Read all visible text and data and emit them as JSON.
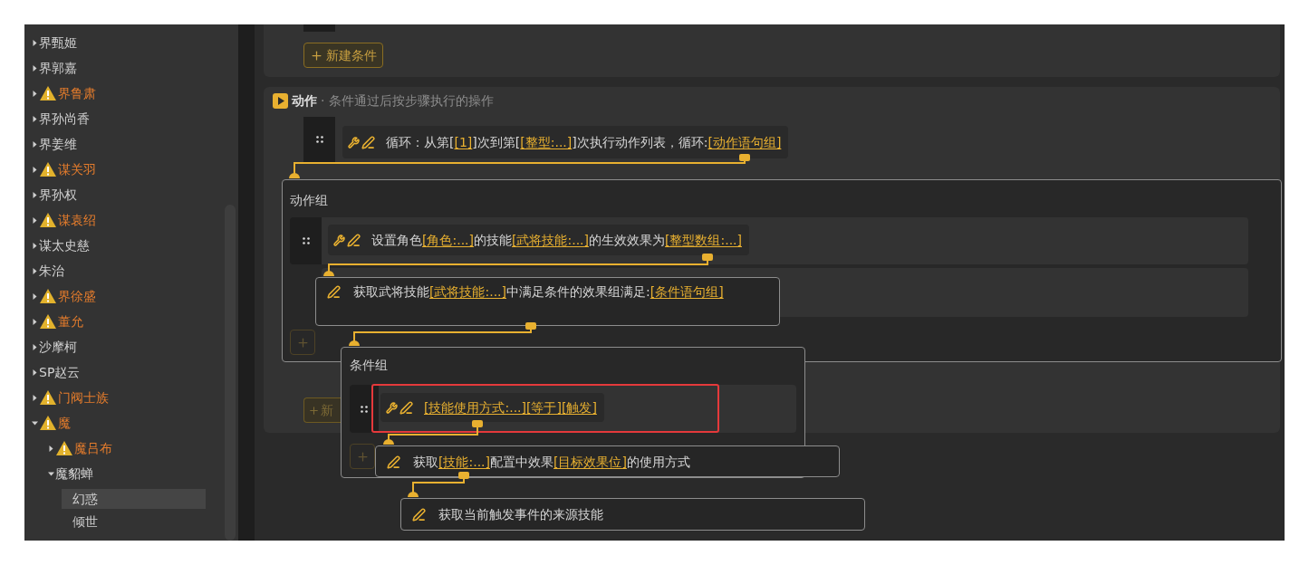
{
  "sidebar": {
    "items": [
      {
        "label": "界甄姬",
        "warning": false,
        "kind": "folder",
        "expanded": false,
        "selected": false
      },
      {
        "label": "界郭嘉",
        "warning": false,
        "kind": "folder",
        "expanded": false,
        "selected": false
      },
      {
        "label": "界鲁肃",
        "warning": true,
        "kind": "folder",
        "expanded": false,
        "selected": false
      },
      {
        "label": "界孙尚香",
        "warning": false,
        "kind": "folder",
        "expanded": false,
        "selected": false
      },
      {
        "label": "界姜维",
        "warning": false,
        "kind": "folder",
        "expanded": false,
        "selected": false
      },
      {
        "label": "谋关羽",
        "warning": true,
        "kind": "folder",
        "expanded": false,
        "selected": false
      },
      {
        "label": "界孙权",
        "warning": false,
        "kind": "folder",
        "expanded": false,
        "selected": false
      },
      {
        "label": "谋袁绍",
        "warning": true,
        "kind": "folder",
        "expanded": false,
        "selected": false
      },
      {
        "label": "谋太史慈",
        "warning": false,
        "kind": "folder",
        "expanded": false,
        "selected": false
      },
      {
        "label": "朱治",
        "warning": false,
        "kind": "folder",
        "expanded": false,
        "selected": false
      },
      {
        "label": "界徐盛",
        "warning": true,
        "kind": "folder",
        "expanded": false,
        "selected": false
      },
      {
        "label": "董允",
        "warning": true,
        "kind": "folder",
        "expanded": false,
        "selected": false
      },
      {
        "label": "沙摩柯",
        "warning": false,
        "kind": "folder",
        "expanded": false,
        "selected": false
      },
      {
        "label": "SP赵云",
        "warning": false,
        "kind": "folder",
        "expanded": false,
        "selected": false
      },
      {
        "label": "门阀士族",
        "warning": true,
        "kind": "folder",
        "expanded": false,
        "selected": false
      },
      {
        "label": "魔",
        "warning": true,
        "kind": "folder",
        "expanded": true,
        "selected": false,
        "children": [
          {
            "label": "魔吕布",
            "warning": true,
            "kind": "folder",
            "expanded": false,
            "selected": false
          },
          {
            "label": "魔貂蝉",
            "warning": false,
            "kind": "folder",
            "expanded": true,
            "selected": false,
            "children": [
              {
                "label": "幻惑",
                "warning": false,
                "kind": "leaf",
                "selected": true
              },
              {
                "label": "倾世",
                "warning": false,
                "kind": "leaf",
                "selected": false
              }
            ]
          }
        ]
      }
    ]
  },
  "conditions_section": {
    "add_button": "新建条件"
  },
  "actions_section": {
    "title": "动作",
    "subtitle": "· 条件通过后按步骤执行的操作",
    "statement": {
      "wrench": true,
      "segments": [
        {
          "kind": "plain",
          "text": "循环：从第["
        },
        {
          "kind": "param",
          "text": "[1]"
        },
        {
          "kind": "plain",
          "text": "]次到第["
        },
        {
          "kind": "param",
          "text": "[整型:...]"
        },
        {
          "kind": "plain",
          "text": "]次执行动作列表，循环:"
        },
        {
          "kind": "param",
          "text": "[动作语句组]"
        }
      ]
    },
    "partial_add_button": "新"
  },
  "action_group": {
    "title": "动作组",
    "statement": {
      "wrench": true,
      "segments": [
        {
          "kind": "plain",
          "text": "设置角色"
        },
        {
          "kind": "param",
          "text": "[角色:...]"
        },
        {
          "kind": "plain",
          "text": "的技能"
        },
        {
          "kind": "param",
          "text": "[武将技能:...]"
        },
        {
          "kind": "plain",
          "text": "的生效效果为"
        },
        {
          "kind": "param",
          "text": "[整型数组:...]"
        }
      ]
    }
  },
  "skill_popup": {
    "wrench": false,
    "segments": [
      {
        "kind": "plain",
        "text": "获取武将技能"
      },
      {
        "kind": "param",
        "text": "[武将技能:...]"
      },
      {
        "kind": "plain",
        "text": "中满足条件的效果组满足:"
      },
      {
        "kind": "param",
        "text": "[条件语句组]"
      }
    ]
  },
  "condition_group": {
    "title": "条件组",
    "highlighted": true,
    "statement": {
      "wrench": true,
      "segments": [
        {
          "kind": "param",
          "text": "[技能使用方式:...]"
        },
        {
          "kind": "param",
          "text": "[等于]"
        },
        {
          "kind": "param",
          "text": "[触发]"
        }
      ]
    }
  },
  "usage_popup": {
    "wrench": false,
    "segments": [
      {
        "kind": "plain",
        "text": "获取"
      },
      {
        "kind": "param",
        "text": "[技能:...]"
      },
      {
        "kind": "plain",
        "text": "配置中效果"
      },
      {
        "kind": "param",
        "text": "[目标效果位]"
      },
      {
        "kind": "plain",
        "text": "的使用方式"
      }
    ]
  },
  "source_popup": {
    "wrench": false,
    "segments": [
      {
        "kind": "plain",
        "text": "获取当前触发事件的来源技能"
      }
    ]
  }
}
